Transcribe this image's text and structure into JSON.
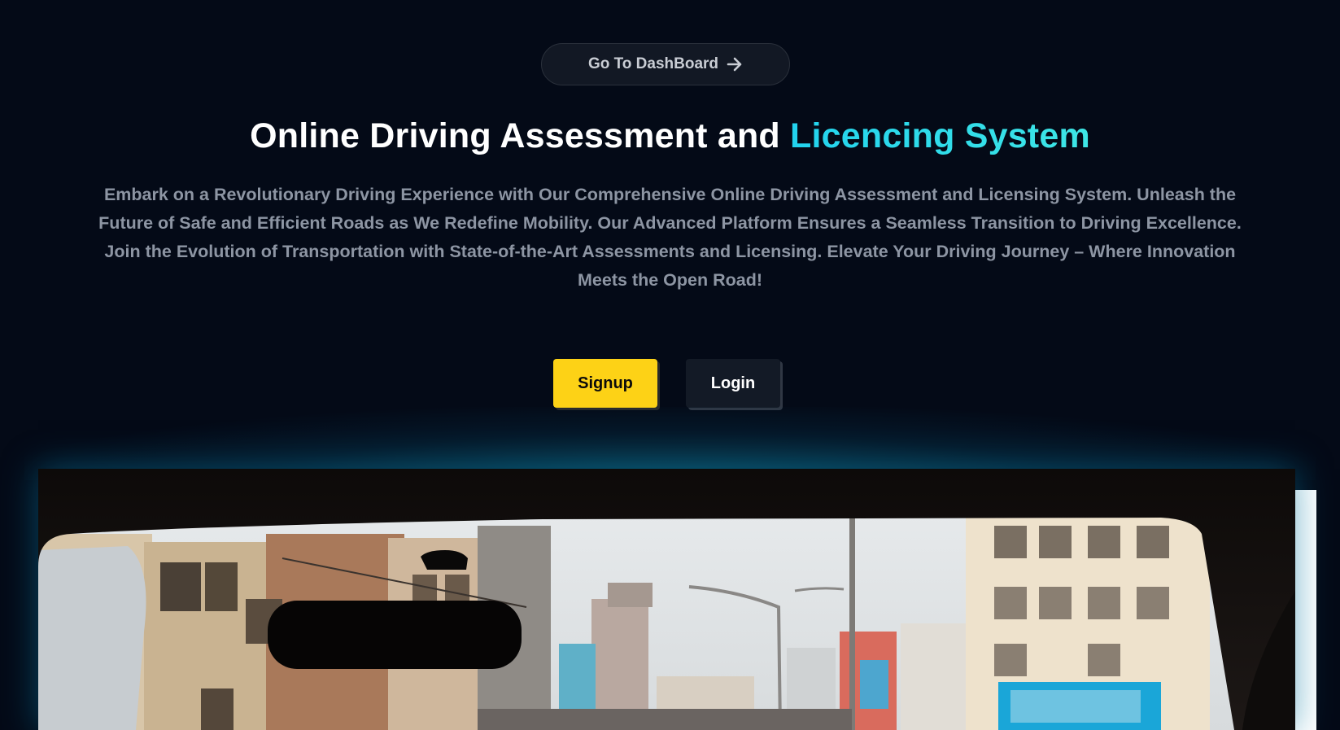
{
  "header": {
    "dashboard_button_label": "Go To DashBoard",
    "dashboard_button_icon": "arrow-right-icon"
  },
  "hero": {
    "title_main": "Online Driving Assessment and ",
    "title_accent": "Licencing System",
    "description": "Embark on a Revolutionary Driving Experience with Our Comprehensive Online Driving Assessment and Licensing System. Unleash the Future of Safe and Efficient Roads as We Redefine Mobility. Our Advanced Platform Ensures a Seamless Transition to Driving Excellence. Join the Evolution of Transportation with State-of-the-Art Assessments and Licensing. Elevate Your Driving Journey – Where Innovation Meets the Open Road!"
  },
  "actions": {
    "signup_label": "Signup",
    "login_label": "Login"
  },
  "colors": {
    "background": "#040a17",
    "accent_gradient_start": "#22d3ee",
    "signup_button": "#fdd216",
    "login_button": "#131a26",
    "description_text": "#8d95a3"
  }
}
